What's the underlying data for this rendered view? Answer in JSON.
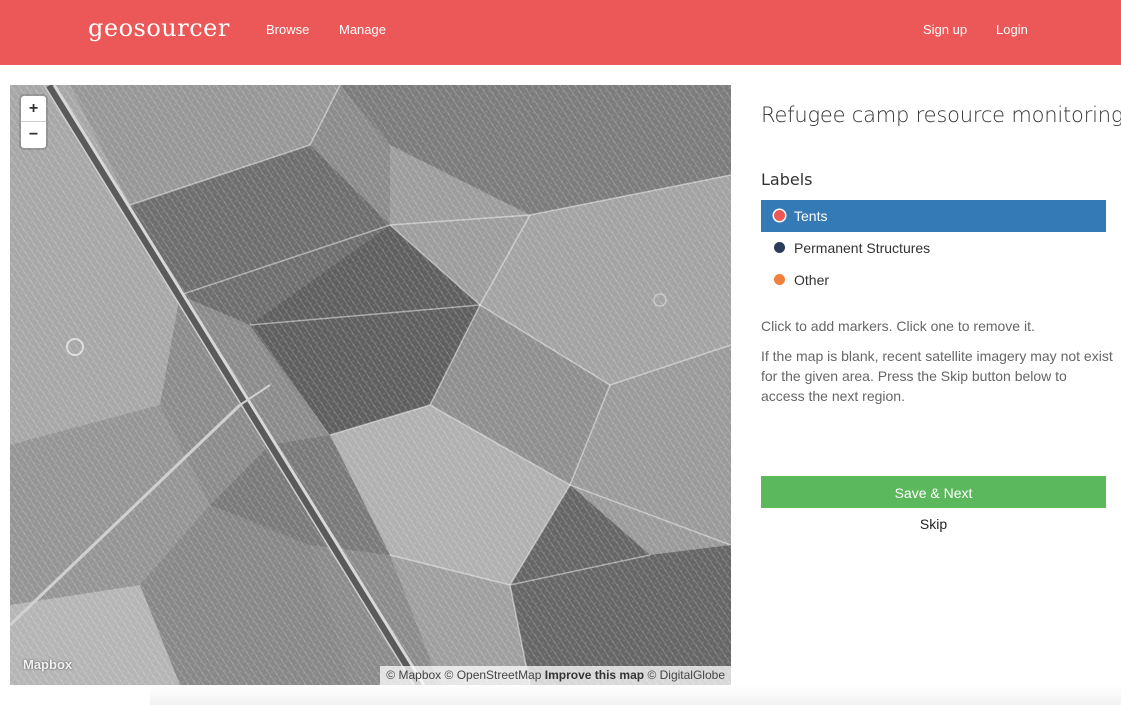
{
  "navbar": {
    "brand": "geosourcer",
    "links": [
      "Browse",
      "Manage"
    ],
    "right_links": [
      "Sign up",
      "Login"
    ],
    "color": "#ec5757"
  },
  "map": {
    "zoom_in": "+",
    "zoom_out": "−",
    "logo": "Mapbox",
    "attribution": {
      "mapbox": "© Mapbox",
      "osm": "© OpenStreetMap",
      "improve": "Improve this map",
      "digitalglobe": "© DigitalGlobe"
    }
  },
  "panel": {
    "title": "Refugee camp resource monitoring",
    "labels_heading": "Labels",
    "labels": [
      {
        "name": "Tents",
        "color": "#ec5757",
        "selected": true
      },
      {
        "name": "Permanent Structures",
        "color": "#2c3e57",
        "selected": false
      },
      {
        "name": "Other",
        "color": "#f0803c",
        "selected": false
      }
    ],
    "help_text_1": "Click to add markers. Click one to remove it.",
    "help_text_2": "If the map is blank, recent satellite imagery may not exist for the given area. Press the Skip button below to access the next region.",
    "save_button": "Save & Next",
    "skip_link": "Skip"
  }
}
